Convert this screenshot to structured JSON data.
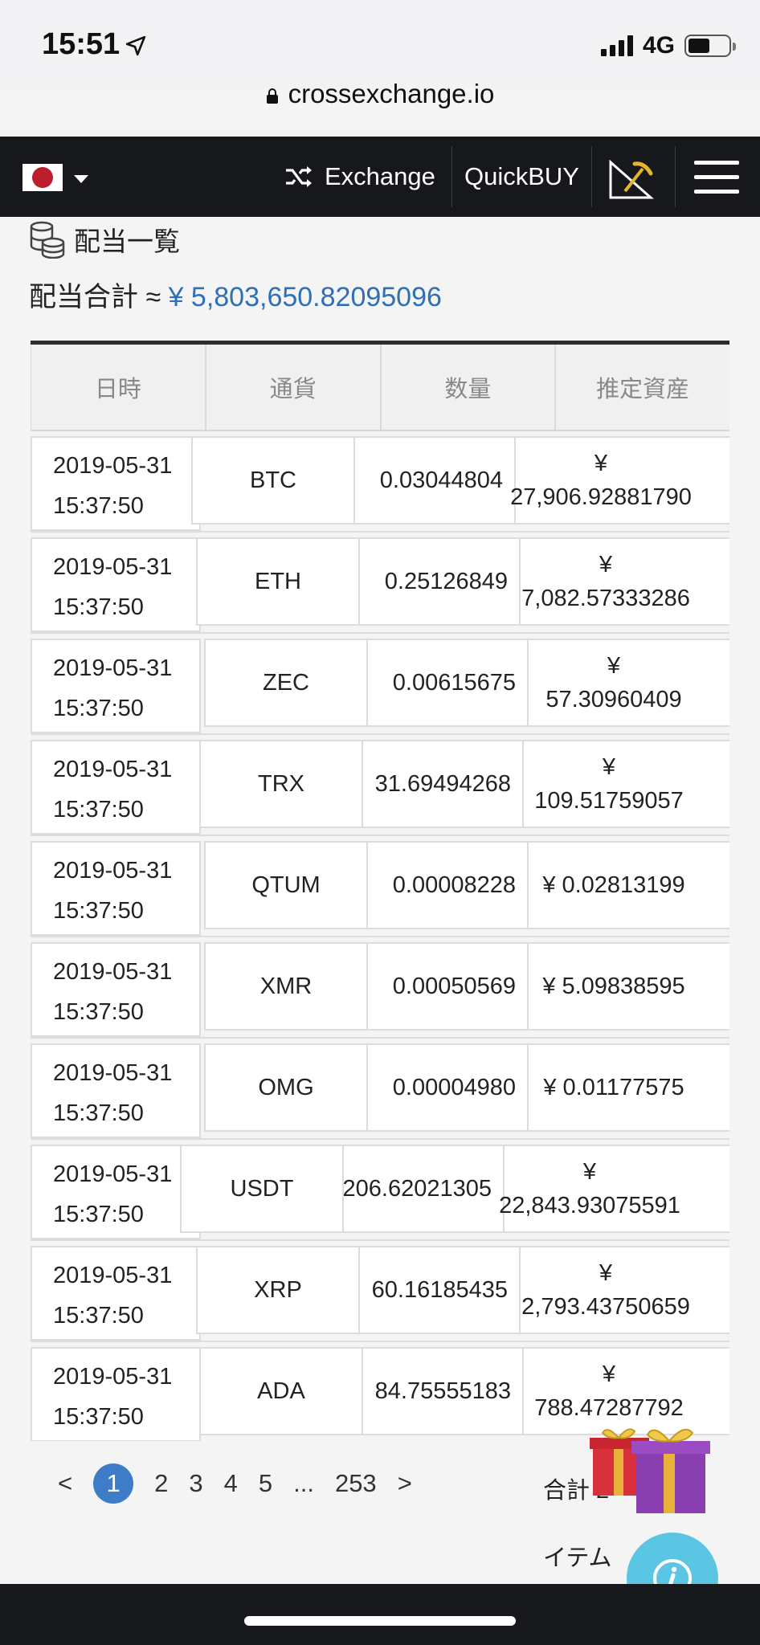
{
  "status": {
    "time": "15:51",
    "network": "4G"
  },
  "browser": {
    "url": "crossexchange.io"
  },
  "nav": {
    "exchange_label": "Exchange",
    "quickbuy_label": "QuickBUY"
  },
  "page": {
    "title": "配当一覧",
    "total_label": "配当合計 ≈",
    "total_value": "¥ 5,803,650.82095096"
  },
  "table": {
    "headers": [
      "日時",
      "通貨",
      "数量",
      "推定資産"
    ],
    "rows": [
      {
        "date": "2019-05-31",
        "time": "15:37:50",
        "currency": "BTC",
        "amount": "0.03044804",
        "yen": "¥",
        "value": "27,906.92881790"
      },
      {
        "date": "2019-05-31",
        "time": "15:37:50",
        "currency": "ETH",
        "amount": "0.25126849",
        "yen": "¥",
        "value": "7,082.57333286"
      },
      {
        "date": "2019-05-31",
        "time": "15:37:50",
        "currency": "ZEC",
        "amount": "0.00615675",
        "yen": "¥",
        "value": "57.30960409"
      },
      {
        "date": "2019-05-31",
        "time": "15:37:50",
        "currency": "TRX",
        "amount": "31.69494268",
        "yen": "¥",
        "value": "109.51759057"
      },
      {
        "date": "2019-05-31",
        "time": "15:37:50",
        "currency": "QTUM",
        "amount": "0.00008228",
        "yen": "¥",
        "value": "0.02813199"
      },
      {
        "date": "2019-05-31",
        "time": "15:37:50",
        "currency": "XMR",
        "amount": "0.00050569",
        "yen": "¥",
        "value": "5.09838595"
      },
      {
        "date": "2019-05-31",
        "time": "15:37:50",
        "currency": "OMG",
        "amount": "0.00004980",
        "yen": "¥",
        "value": "0.01177575"
      },
      {
        "date": "2019-05-31",
        "time": "15:37:50",
        "currency": "USDT",
        "amount": "206.62021305",
        "yen": "¥",
        "value": "22,843.93075591"
      },
      {
        "date": "2019-05-31",
        "time": "15:37:50",
        "currency": "XRP",
        "amount": "60.16185435",
        "yen": "¥",
        "value": "2,793.43750659"
      },
      {
        "date": "2019-05-31",
        "time": "15:37:50",
        "currency": "ADA",
        "amount": "84.75555183",
        "yen": "¥",
        "value": "788.47287792"
      }
    ]
  },
  "pagination": {
    "prev": "<",
    "pages": [
      "1",
      "2",
      "3",
      "4",
      "5"
    ],
    "ellipsis": "...",
    "last": "253",
    "next": ">",
    "total_label": "合計 2",
    "item_label": "イテム"
  },
  "colors": {
    "accent": "#2f6fb5",
    "nav_bg": "#16181b",
    "info_button": "#5bc6e4"
  }
}
